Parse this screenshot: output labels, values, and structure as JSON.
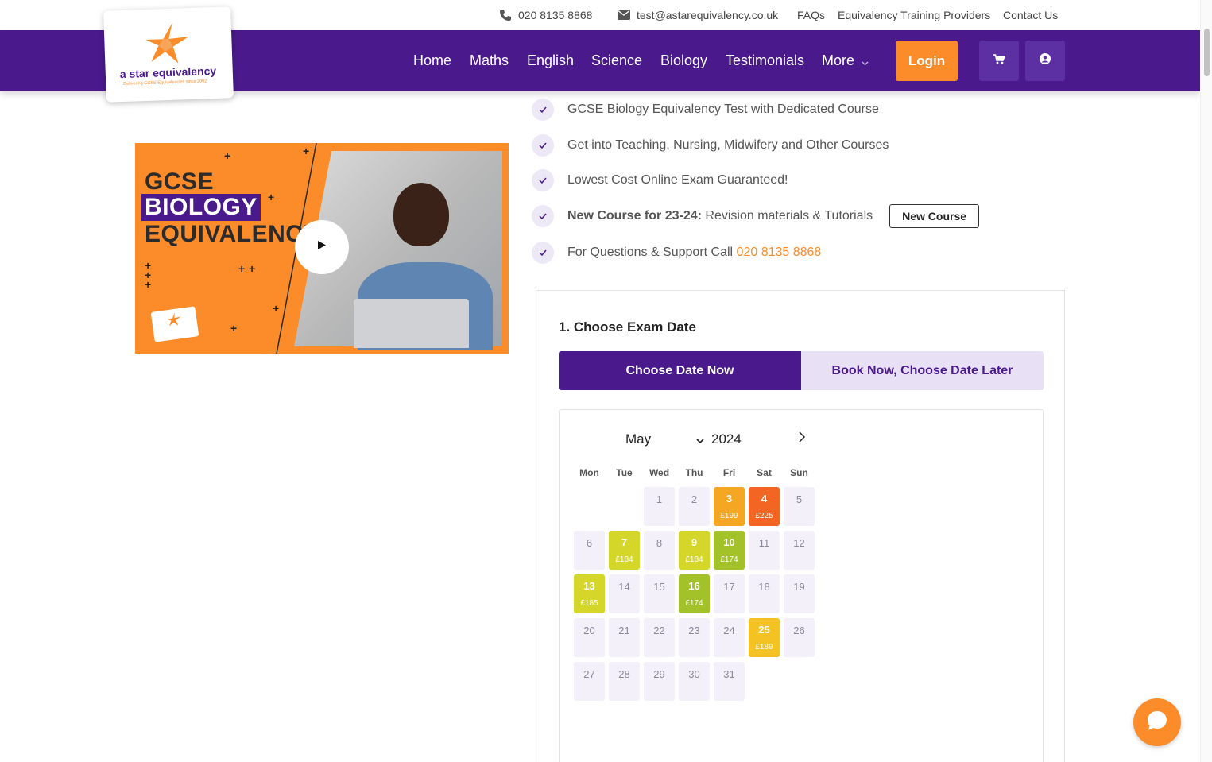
{
  "topbar": {
    "phone": "020 8135 8868",
    "email": "test@astarequivalency.co.uk",
    "links": [
      "FAQs",
      "Equivalency Training Providers",
      "Contact Us"
    ]
  },
  "logo": {
    "brand": "a star equivalency",
    "tagline": "Delivering GCSE Equivalencies since 2002"
  },
  "nav": {
    "links": [
      "Home",
      "Maths",
      "English",
      "Science",
      "Biology",
      "Testimonials",
      "More"
    ],
    "login_label": "Login",
    "cart_icon": "cart-icon",
    "user_icon": "user-icon"
  },
  "video": {
    "line1": "GCSE",
    "line2": "BIOLOGY",
    "line3": "EQUIVALENCY",
    "play_icon": "play-icon"
  },
  "features": [
    {
      "text": "GCSE Biology Equivalency Test with Dedicated Course"
    },
    {
      "text": "Get into Teaching, Nursing, Midwifery and Other Courses"
    },
    {
      "text": "Lowest Cost Online Exam Guaranteed!"
    },
    {
      "bold": "New Course for 23-24:",
      "text": " Revision materials & Tutorials",
      "button": "New Course"
    },
    {
      "text": "For Questions & Support Call ",
      "phone": "020 8135 8868"
    }
  ],
  "booking": {
    "title": "1. Choose Exam Date",
    "tab_active": "Choose Date Now",
    "tab_inactive": "Book Now, Choose Date Later",
    "month": "May",
    "year": "2024",
    "weekdays": [
      "Mon",
      "Tue",
      "Wed",
      "Thu",
      "Fri",
      "Sat",
      "Sun"
    ],
    "first_weekday": 2,
    "days_in_month": 31,
    "available": {
      "3": {
        "price": "£199",
        "color": "#f5a623"
      },
      "4": {
        "price": "£225",
        "color": "#f26522"
      },
      "7": {
        "price": "£184",
        "color": "#d4d62a"
      },
      "9": {
        "price": "£184",
        "color": "#d4d62a"
      },
      "10": {
        "price": "£174",
        "color": "#a3c229"
      },
      "13": {
        "price": "£185",
        "color": "#d4d62a"
      },
      "16": {
        "price": "£174",
        "color": "#a3c229"
      },
      "25": {
        "price": "£189",
        "color": "#f5c223"
      }
    }
  },
  "colors": {
    "brand_purple": "#4a1a8c",
    "accent_orange": "#fb8c29"
  }
}
